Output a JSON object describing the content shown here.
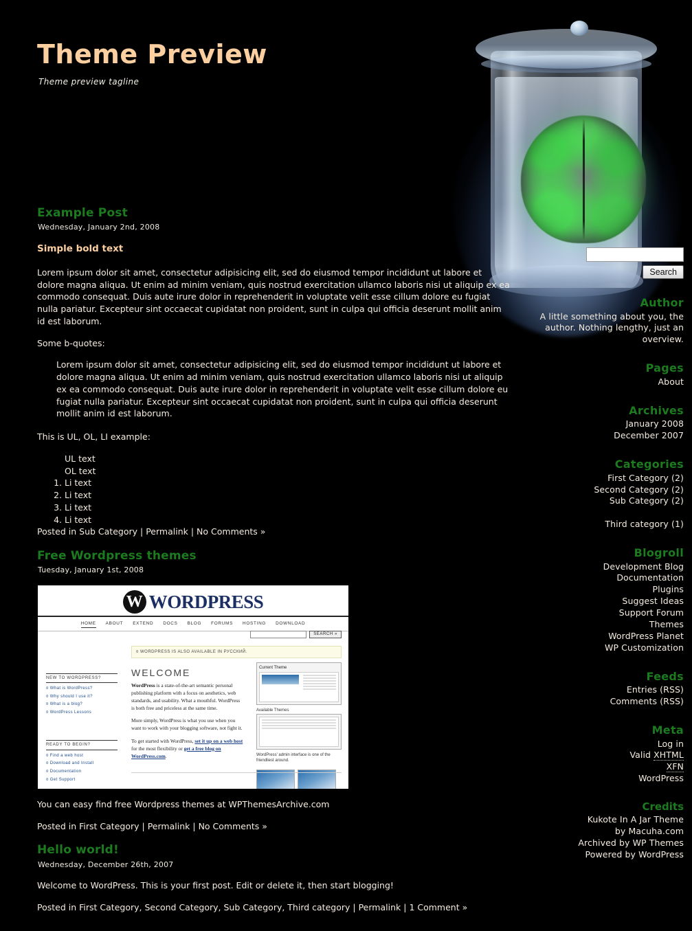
{
  "site": {
    "title": "Theme Preview",
    "tagline": "Theme preview tagline"
  },
  "colors": {
    "heading_green": "#1c7a1f",
    "title_peach": "#fbcfa0",
    "body_text": "#f5ece0",
    "background": "#000000"
  },
  "header_art": {
    "name": "brain-in-a-jar",
    "description": "Green and gray human brain suspended in a glass jar with blue backlight glow"
  },
  "posts": [
    {
      "title": "Example Post",
      "date": "Wednesday, January 2nd, 2008",
      "bold_heading": "Simple bold text",
      "paragraph1": "Lorem ipsum dolor sit amet, consectetur adipisicing elit, sed do eiusmod tempor incididunt ut labore et dolore magna aliqua. Ut enim ad minim veniam, quis nostrud exercitation ullamco laboris nisi ut aliquip ex ea commodo consequat. Duis aute irure dolor in reprehenderit in voluptate velit esse cillum dolore eu fugiat nulla pariatur. Excepteur sint occaecat cupidatat non proident, sunt in culpa qui officia deserunt mollit anim id est laborum.",
      "quote_intro": "Some b-quotes:",
      "blockquote": "Lorem ipsum dolor sit amet, consectetur adipisicing elit, sed do eiusmod tempor incididunt ut labore et dolore magna aliqua. Ut enim ad minim veniam, quis nostrud exercitation ullamco laboris nisi ut aliquip ex ea commodo consequat. Duis aute irure dolor in reprehenderit in voluptate velit esse cillum dolore eu fugiat nulla pariatur. Excepteur sint occaecat cupidatat non proident, sunt in culpa qui officia deserunt mollit anim id est laborum.",
      "list_intro": "This is UL, OL, LI example:",
      "ul_text": "UL text",
      "ol_text": "OL text",
      "li_items": [
        "Li text",
        "Li text",
        "Li text",
        "Li text"
      ],
      "meta": {
        "posted_in_label": "Posted in",
        "categories": "Sub Category",
        "permalink": "Permalink",
        "comments": "No Comments »",
        "sep": "|"
      }
    },
    {
      "title": "Free Wordpress themes",
      "date": "Tuesday, January 1st, 2008",
      "paragraph1": "You can easy find free Wordpress themes at WPThemesArchive.com",
      "image_alt": "WordPress.org homepage screenshot",
      "meta": {
        "posted_in_label": "Posted in",
        "categories": "First Category",
        "permalink": "Permalink",
        "comments": "No Comments »",
        "sep": "|"
      }
    },
    {
      "title": "Hello world!",
      "date": "Wednesday, December 26th, 2007",
      "paragraph1": "Welcome to WordPress. This is your first post. Edit or delete it, then start blogging!",
      "meta": {
        "posted_in_label": "Posted in",
        "categories": "First Category, Second Category, Sub Category, Third category",
        "permalink": "Permalink",
        "comments": "1 Comment »",
        "sep": "|"
      }
    }
  ],
  "wp_screenshot": {
    "wordmark": "WORDPRESS",
    "mark_letter": "W",
    "nav": [
      "HOME",
      "ABOUT",
      "EXTEND",
      "DOCS",
      "BLOG",
      "FORUMS",
      "HOSTING",
      "DOWNLOAD"
    ],
    "search_button": "SEARCH »",
    "notice": "¤ WORDPRESS IS ALSO AVAILABLE IN РУССКИЙ.",
    "welcome": "WELCOME",
    "body1_lead": "WordPress",
    "body1": " is a state-of-the-art semantic personal publishing platform with a focus on aesthetics, web standards, and usability. What a mouthful. WordPress is both free and priceless at the same time.",
    "body2": "More simply, WordPress is what you use when you want to work with your blogging software, not fight it.",
    "body3_pre": "To get started with WordPress, ",
    "body3_link1": "set it up on a web host",
    "body3_mid": " for the most flexibility or ",
    "body3_link2": "get a free blog on WordPress.com",
    "body3_end": ".",
    "left_col": {
      "head1": "NEW TO WORDPRESS?",
      "items1": [
        "¤ What is WordPress?",
        "¤ Why should I use it?",
        "¤ What is a blog?",
        "¤ WordPress Lessons"
      ],
      "head2": "READY TO BEGIN?",
      "items2": [
        "¤ Find a web host",
        "¤ Download and Install",
        "¤ Documentation",
        "¤ Get Support"
      ]
    },
    "right_col": {
      "card_title": "Current Theme",
      "card_sub": "WordPress Default 1.5 by Michael Heilemann",
      "card_note": "The default WordPress theme based on the famous",
      "available": "Available Themes",
      "caption": "WordPress' admin interface is one of the friendliest around."
    }
  },
  "sidebar": {
    "search": {
      "value": "",
      "placeholder": "",
      "button_label": "Search"
    },
    "blocks": [
      {
        "heading": "Author",
        "type": "text",
        "text": "A little something about you, the author. Nothing lengthy, just an overview."
      },
      {
        "heading": "Pages",
        "type": "list",
        "items": [
          "About"
        ]
      },
      {
        "heading": "Archives",
        "type": "list",
        "items": [
          "January 2008",
          "December 2007"
        ]
      },
      {
        "heading": "Categories",
        "type": "list",
        "items": [
          "First Category  (2)",
          "Second Category  (2)",
          "Sub Category  (2)",
          "",
          "Third category  (1)"
        ]
      },
      {
        "heading": "Blogroll",
        "type": "list",
        "items": [
          "Development Blog",
          "Documentation",
          "Plugins",
          "Suggest Ideas",
          "Support Forum",
          "Themes",
          "WordPress Planet",
          "WP Customization"
        ]
      },
      {
        "heading": "Feeds",
        "type": "list",
        "items": [
          "Entries (RSS)",
          "Comments (RSS)"
        ]
      }
    ],
    "meta": {
      "heading": "Meta",
      "login": "Log in",
      "valid_prefix": "Valid ",
      "valid_abbr": "XHTML",
      "xfn": "XFN",
      "wordpress": "WordPress"
    },
    "credits": {
      "heading": "Credits",
      "line1": "Kukote In A Jar Theme",
      "line2": "by Macuha.com",
      "line3": "Archived by  WP Themes",
      "line4": "Powered by  WordPress"
    }
  }
}
